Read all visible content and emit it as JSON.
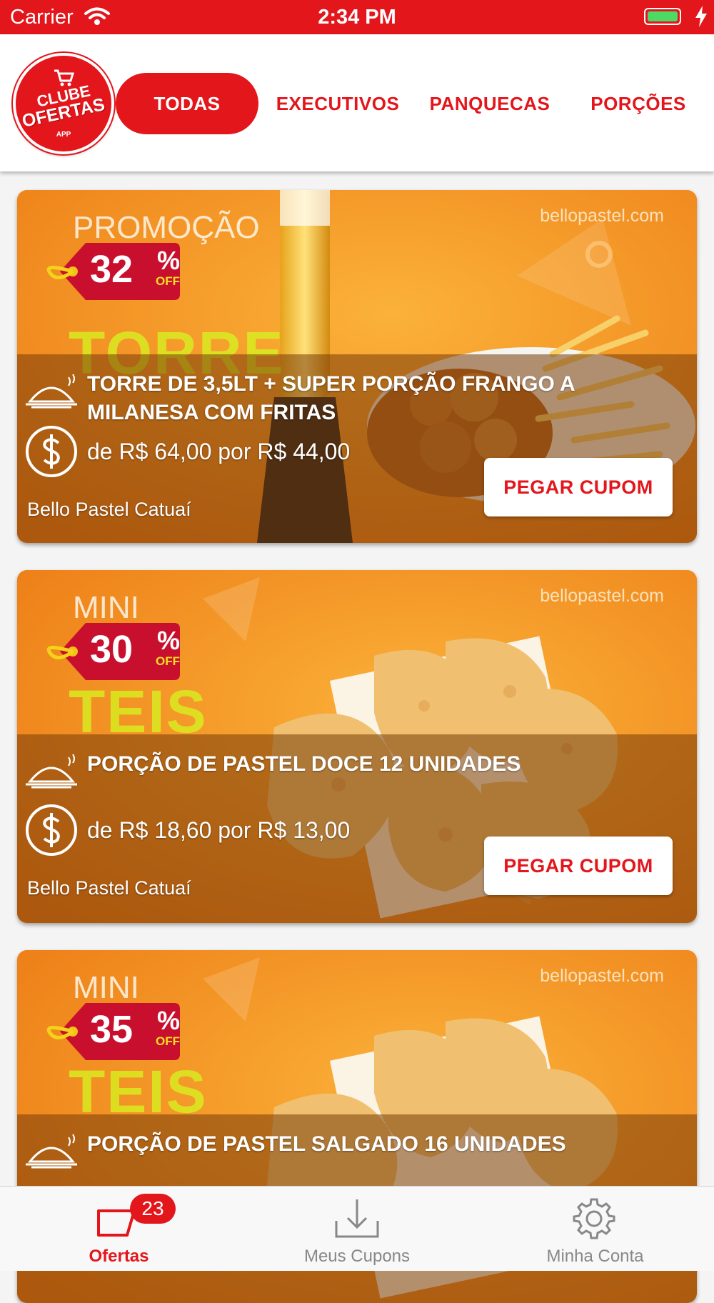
{
  "status_bar": {
    "carrier": "Carrier",
    "time": "2:34 PM"
  },
  "header": {
    "logo": {
      "line1": "CLUBE",
      "line2": "OFERTAS",
      "line3": "APP"
    },
    "tabs": [
      {
        "label": "TODAS",
        "active": true
      },
      {
        "label": "EXECUTIVOS",
        "active": false
      },
      {
        "label": "PANQUECAS",
        "active": false
      },
      {
        "label": "PORÇÕES",
        "active": false
      }
    ]
  },
  "offers": [
    {
      "banner_heading": "PROMOÇÃO",
      "banner_domain": "bellopastel.com",
      "discount_number": "32",
      "discount_pct": "%",
      "discount_off": "OFF",
      "title": "TORRE DE 3,5LT + SUPER PORÇÃO FRANGO A MILANESA COM FRITAS",
      "price": "de R$ 64,00 por R$ 44,00",
      "store": "Bello Pastel Catuaí",
      "cta": "PEGAR CUPOM"
    },
    {
      "banner_heading": "MINI",
      "banner_domain": "bellopastel.com",
      "discount_number": "30",
      "discount_pct": "%",
      "discount_off": "OFF",
      "title": "PORÇÃO DE PASTEL DOCE 12 UNIDADES",
      "price": "de R$ 18,60 por R$ 13,00",
      "store": "Bello Pastel Catuaí",
      "cta": "PEGAR CUPOM"
    },
    {
      "banner_heading": "MINI",
      "banner_domain": "bellopastel.com",
      "discount_number": "35",
      "discount_pct": "%",
      "discount_off": "OFF",
      "title": "PORÇÃO DE PASTEL SALGADO 16 UNIDADES"
    }
  ],
  "tab_bar": {
    "items": [
      {
        "label": "Ofertas",
        "icon": "ticket-icon",
        "badge": "23",
        "active": true
      },
      {
        "label": "Meus Cupons",
        "icon": "download-icon",
        "active": false
      },
      {
        "label": "Minha Conta",
        "icon": "gear-icon",
        "active": false
      }
    ]
  },
  "colors": {
    "brand_red": "#e3161c",
    "banner_orange": "#f28d1e",
    "tag_red": "#c8102e"
  }
}
